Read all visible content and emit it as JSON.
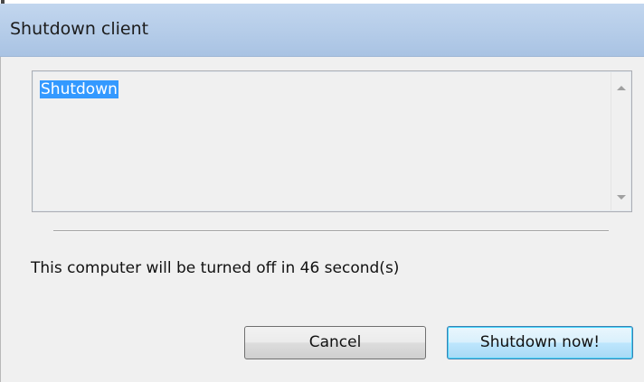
{
  "window": {
    "title": "Shutdown client"
  },
  "message_box": {
    "text": "Shutdown"
  },
  "status": {
    "text": "This computer will be turned off in 46 second(s)",
    "seconds_remaining": 46
  },
  "buttons": {
    "cancel_label": "Cancel",
    "shutdown_label": "Shutdown now!"
  },
  "colors": {
    "titlebar": "#b6cde9",
    "client_background": "#f0f0f0",
    "selection": "#3399ff",
    "default_button_border": "#3c7fb1"
  },
  "icons": {
    "scroll_up": "scroll-up-arrow-icon",
    "scroll_down": "scroll-down-arrow-icon"
  }
}
